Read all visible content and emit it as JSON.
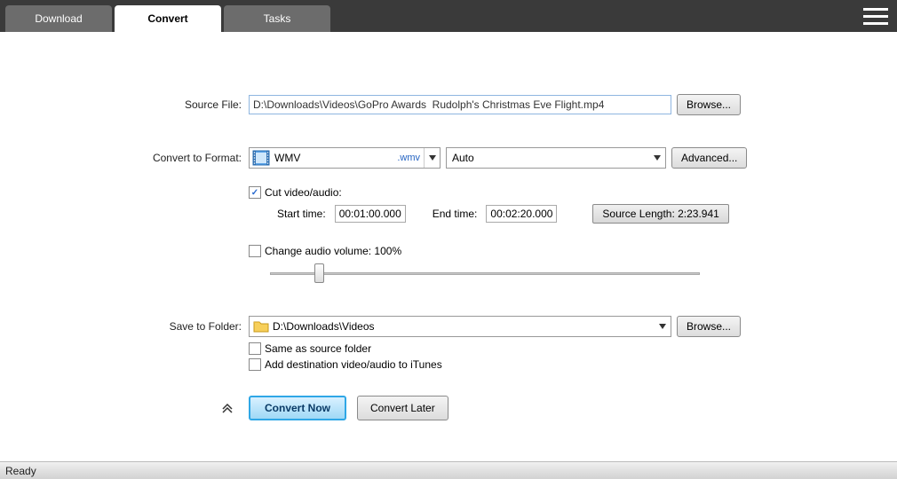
{
  "tabs": {
    "download": "Download",
    "convert": "Convert",
    "tasks": "Tasks"
  },
  "labels": {
    "source_file": "Source File:",
    "convert_to_format": "Convert to Format:",
    "save_to_folder": "Save to Folder:",
    "cut_video_audio": "Cut video/audio:",
    "start_time": "Start time:",
    "end_time": "End time:",
    "change_audio_volume": "Change audio volume: 100%",
    "same_as_source": "Same as source folder",
    "add_to_itunes": "Add destination video/audio to iTunes"
  },
  "buttons": {
    "browse": "Browse...",
    "advanced": "Advanced...",
    "source_length": "Source Length: 2:23.941",
    "convert_now": "Convert Now",
    "convert_later": "Convert Later"
  },
  "fields": {
    "source_path": "D:\\Downloads\\Videos\\GoPro Awards  Rudolph's Christmas Eve Flight.mp4",
    "format_name": "WMV",
    "format_ext": ".wmv",
    "quality": "Auto",
    "start_time": "00:01:00.000",
    "end_time": "00:02:20.000",
    "save_folder": "D:\\Downloads\\Videos"
  },
  "status": "Ready"
}
